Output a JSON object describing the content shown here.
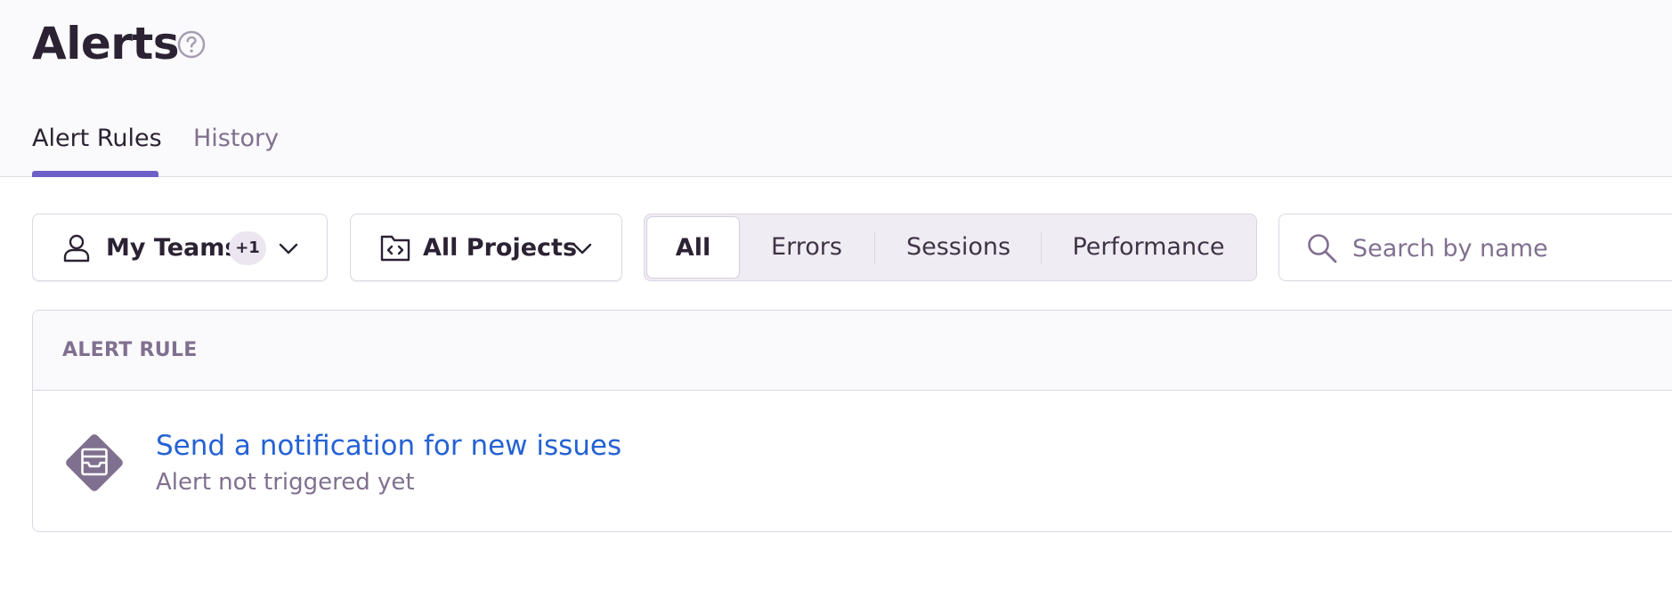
{
  "header": {
    "title": "Alerts",
    "tabs": [
      {
        "label": "Alert Rules",
        "active": true
      },
      {
        "label": "History",
        "active": false
      }
    ]
  },
  "filters": {
    "teams": {
      "label": "My Teams",
      "badge": "+1"
    },
    "projects": {
      "label": "All Projects"
    },
    "segments": [
      "All",
      "Errors",
      "Sessions",
      "Performance"
    ],
    "selected_segment": "All",
    "search": {
      "placeholder": "Search by name",
      "value": ""
    }
  },
  "table": {
    "column_header": "ALERT RULE",
    "rows": [
      {
        "title": "Send a notification for new issues",
        "status": "Alert not triggered yet"
      }
    ]
  },
  "colors": {
    "accent": "#6c5fc7",
    "link": "#2562d4",
    "muted": "#80708f",
    "alert_icon": "#80708f"
  },
  "icons": {
    "help": "help-circle-icon",
    "teams": "user-icon",
    "projects": "project-folder-icon",
    "chevron": "chevron-down-icon",
    "search": "search-icon",
    "alert_rule": "issue-alert-icon"
  }
}
